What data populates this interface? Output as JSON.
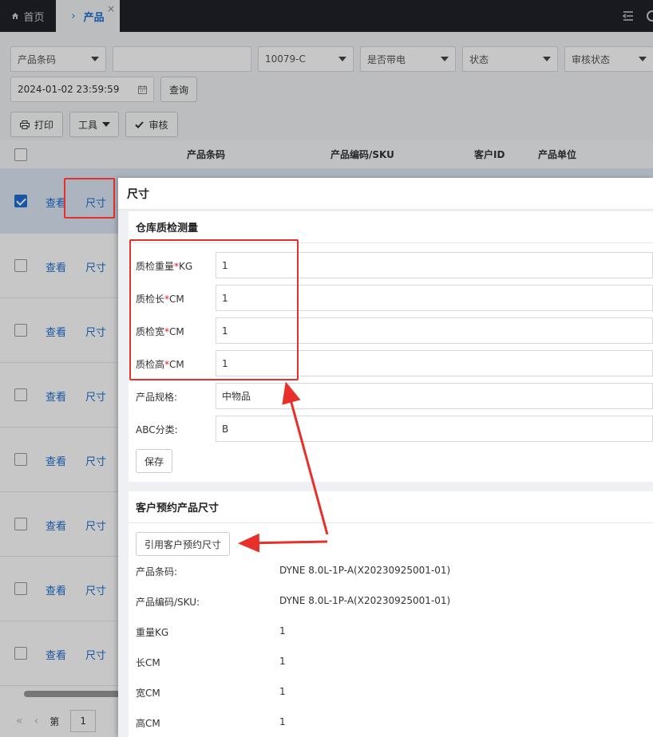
{
  "tabs": {
    "home": "首页",
    "active": "产品",
    "close": "×"
  },
  "filters": {
    "barcode_type": "产品条码",
    "barcode_value": "",
    "customer": "10079-C",
    "battery": "是否带电",
    "status": "状态",
    "audit_status": "审核状态",
    "datetime": "2024-01-02 23:59:59",
    "query_button": "查询"
  },
  "toolbar": {
    "print": "打印",
    "tools": "工具",
    "audit": "审核"
  },
  "grid": {
    "columns": [
      "产品条码",
      "产品编码/SKU",
      "客户ID",
      "产品单位"
    ],
    "row_actions": [
      "查看",
      "尺寸"
    ],
    "row_count": 8
  },
  "pager": {
    "page_label": "第",
    "page_value": "1"
  },
  "modal": {
    "title": "尺寸",
    "warehouse_section": {
      "title": "仓库质检测量",
      "fields": [
        {
          "label": "质检重量",
          "unit": "KG",
          "required": true,
          "value": "1"
        },
        {
          "label": "质检长",
          "unit": "CM",
          "required": true,
          "value": "1"
        },
        {
          "label": "质检宽",
          "unit": "CM",
          "required": true,
          "value": "1"
        },
        {
          "label": "质检高",
          "unit": "CM",
          "required": true,
          "value": "1"
        },
        {
          "label": "产品规格:",
          "unit": "",
          "required": false,
          "value": "中物品"
        },
        {
          "label": "ABC分类:",
          "unit": "",
          "required": false,
          "value": "B"
        }
      ],
      "save_button": "保存"
    },
    "customer_section": {
      "title": "客户预约产品尺寸",
      "cite_button": "引用客户预约尺寸",
      "details": [
        {
          "label": "产品条码:",
          "value": "DYNE 8.0L-1P-A(X20230925001-01)"
        },
        {
          "label": "产品编码/SKU:",
          "value": "DYNE 8.0L-1P-A(X20230925001-01)"
        },
        {
          "label": "重量KG",
          "value": "1"
        },
        {
          "label": "长CM",
          "value": "1"
        },
        {
          "label": "宽CM",
          "value": "1"
        },
        {
          "label": "高CM",
          "value": "1"
        }
      ]
    }
  },
  "colors": {
    "accent": "#1e6fd0",
    "topbar": "#1f2229",
    "annotation": "#e8302a"
  }
}
